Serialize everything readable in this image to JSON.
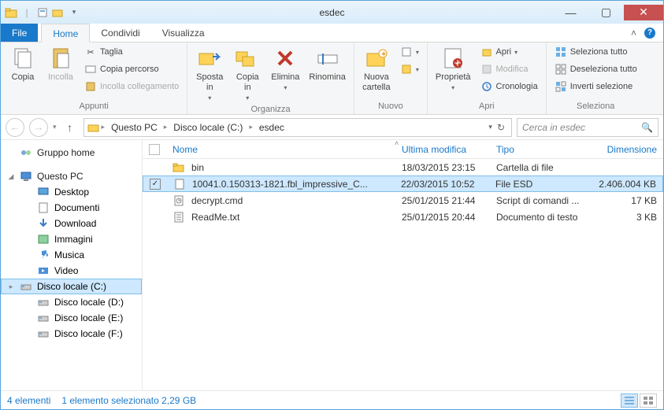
{
  "window": {
    "title": "esdec"
  },
  "tabs": {
    "file": "File",
    "home": "Home",
    "share": "Condividi",
    "view": "Visualizza"
  },
  "ribbon": {
    "clipboard": {
      "label": "Appunti",
      "copy": "Copia",
      "paste": "Incolla",
      "cut": "Taglia",
      "copy_path": "Copia percorso",
      "paste_shortcut": "Incolla collegamento"
    },
    "organize": {
      "label": "Organizza",
      "move_to": "Sposta\nin",
      "copy_to": "Copia\nin",
      "delete": "Elimina",
      "rename": "Rinomina"
    },
    "new": {
      "label": "Nuovo",
      "new_folder": "Nuova\ncartella"
    },
    "open": {
      "label": "Apri",
      "properties": "Proprietà",
      "open": "Apri",
      "edit": "Modifica",
      "history": "Cronologia"
    },
    "select": {
      "label": "Seleziona",
      "select_all": "Seleziona tutto",
      "select_none": "Deseleziona tutto",
      "invert": "Inverti selezione"
    }
  },
  "nav": {
    "segments": [
      "Questo PC",
      "Disco locale (C:)",
      "esdec"
    ],
    "search_placeholder": "Cerca in esdec"
  },
  "sidebar": {
    "homegroup": "Gruppo home",
    "this_pc": "Questo PC",
    "items": [
      "Desktop",
      "Documenti",
      "Download",
      "Immagini",
      "Musica",
      "Video",
      "Disco locale (C:)",
      "Disco locale (D:)",
      "Disco locale (E:)",
      "Disco locale (F:)"
    ]
  },
  "columns": {
    "name": "Nome",
    "modified": "Ultima modifica",
    "type": "Tipo",
    "size": "Dimensione"
  },
  "rows": [
    {
      "name": "bin",
      "modified": "18/03/2015 23:15",
      "type": "Cartella di file",
      "size": "",
      "icon": "folder",
      "selected": false
    },
    {
      "name": "10041.0.150313-1821.fbl_impressive_C...",
      "modified": "22/03/2015 10:52",
      "type": "File ESD",
      "size": "2.406.004 KB",
      "icon": "file",
      "selected": true
    },
    {
      "name": "decrypt.cmd",
      "modified": "25/01/2015 21:44",
      "type": "Script di comandi ...",
      "size": "17 KB",
      "icon": "cmd",
      "selected": false
    },
    {
      "name": "ReadMe.txt",
      "modified": "25/01/2015 20:44",
      "type": "Documento di testo",
      "size": "3 KB",
      "icon": "txt",
      "selected": false
    }
  ],
  "status": {
    "items": "4 elementi",
    "selected": "1 elemento selezionato  2,29 GB"
  }
}
